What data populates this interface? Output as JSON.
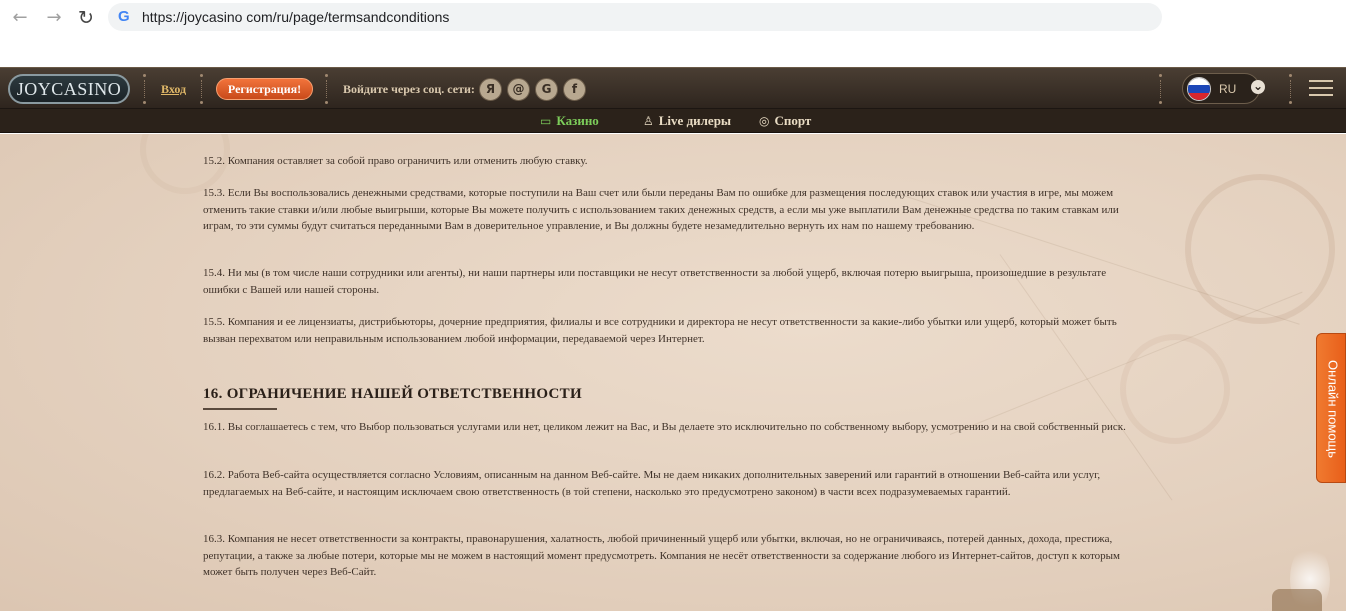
{
  "browser": {
    "back_icon": "arrow-left-icon",
    "forward_icon": "arrow-right-icon",
    "reload_icon": "reload-icon",
    "url": "https://joycasino com/ru/page/termsandconditions"
  },
  "header": {
    "logo_text": "JOYCASINO",
    "login_label": "Вход",
    "register_label": "Регистрация!",
    "social_label": "Войдите через соц. сети:",
    "social": [
      "Я",
      "@",
      "G",
      "f"
    ],
    "language": "RU"
  },
  "subnav": {
    "items": [
      {
        "label": "Казино",
        "icon": "slot-machine-icon",
        "active": true
      },
      {
        "label": "Live дилеры",
        "icon": "dealer-icon",
        "active": false
      },
      {
        "label": "Спорт",
        "icon": "ball-icon",
        "active": false
      }
    ]
  },
  "content": {
    "p15_2": "15.2. Компания оставляет за собой право ограничить или отменить любую ставку.",
    "p15_3": "15.3. Если Вы воспользовались денежными средствами, которые поступили на Ваш счет или были переданы Вам по ошибке для размещения последующих ставок или участия в игре, мы можем отменить такие ставки и/или любые выигрыши, которые Вы можете получить с использованием таких денежных средств, а если мы уже выплатили Вам денежные средства по таким ставкам или играм, то эти суммы будут считаться переданными Вам в доверительное управление, и Вы должны будете незамедлительно вернуть их нам по нашему требованию.",
    "p15_4": "15.4. Ни мы (в том числе наши сотрудники или агенты), ни наши партнеры или поставщики не несут ответственности за любой ущерб, включая потерю выигрыша, произошедшие в результате ошибки с Вашей или нашей стороны.",
    "p15_5": "15.5. Компания и ее лицензиаты, дистрибьюторы, дочерние предприятия, филиалы и все сотрудники и директора не несут ответственности за какие-либо убытки или ущерб, который может быть вызван перехватом или неправильным использованием любой информации, передаваемой через Интернет.",
    "section16_title": "16. ОГРАНИЧЕНИЕ НАШЕЙ ОТВЕТСТВЕННОСТИ",
    "p16_1": "16.1. Вы соглашаетесь с тем, что Выбор пользоваться услугами или нет, целиком лежит на Вас, и Вы делаете это исключительно по собственному выбору, усмотрению и на свой собственный риск.",
    "p16_2": "16.2. Работа Веб-сайта осуществляется согласно Условиям, описанным на данном Веб-сайте. Мы не даем никаких дополнительных заверений или гарантий в отношении Веб-сайта или услуг, предлагаемых на Веб-сайте, и настоящим исключаем свою ответственность (в той степени, насколько это предусмотрено законом) в части всех подразумеваемых гарантий.",
    "p16_3": "16.3. Компания не несет ответственности за контракты, правонарушения, халатность, любой причиненный ущерб или убытки, включая, но не ограничиваясь, потерей данных, дохода, престижа, репутации, а также за любые потери, которые мы не можем в настоящий момент предусмотреть. Компания не несёт ответственности за содержание любого из Интернет-сайтов, доступ к которым может быть получен через Веб-Сайт."
  },
  "help_tab": "Онлайн помощь",
  "colors": {
    "accent_orange": "#e85f1a",
    "active_green": "#7ccc5a",
    "header_brown": "#2e251e",
    "page_beige": "#e4d1bf"
  }
}
